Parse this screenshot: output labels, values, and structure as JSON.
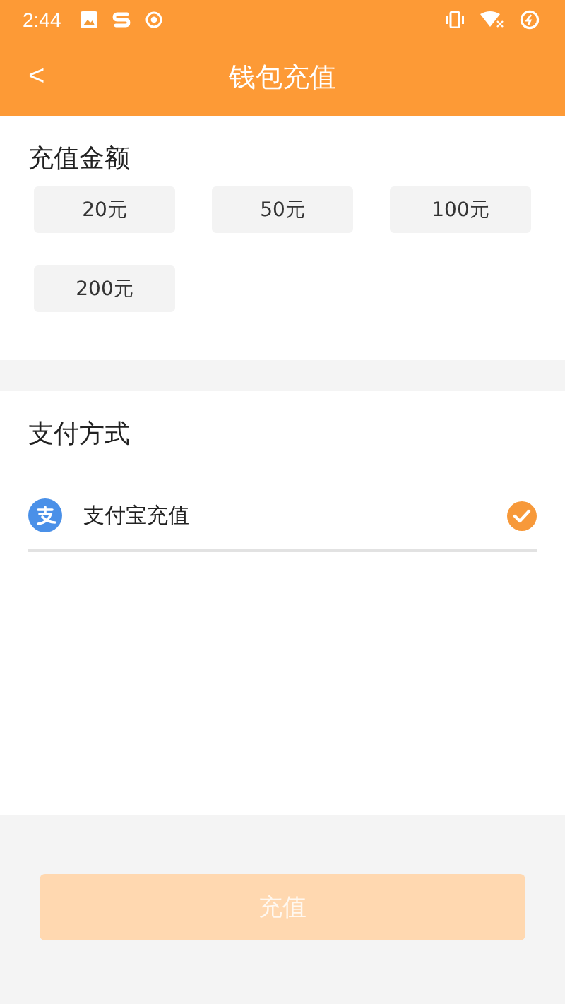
{
  "status_bar": {
    "time": "2:44"
  },
  "header": {
    "title": "钱包充值",
    "back": "<"
  },
  "amount_section": {
    "title": "充值金额",
    "options": [
      {
        "label": "20元",
        "selected": false
      },
      {
        "label": "50元",
        "selected": false
      },
      {
        "label": "100元",
        "selected": false
      },
      {
        "label": "200元",
        "selected": false
      }
    ]
  },
  "payment_section": {
    "title": "支付方式",
    "methods": [
      {
        "label": "支付宝充值",
        "checked": true
      }
    ]
  },
  "submit": {
    "label": "充值",
    "disabled": true
  }
}
